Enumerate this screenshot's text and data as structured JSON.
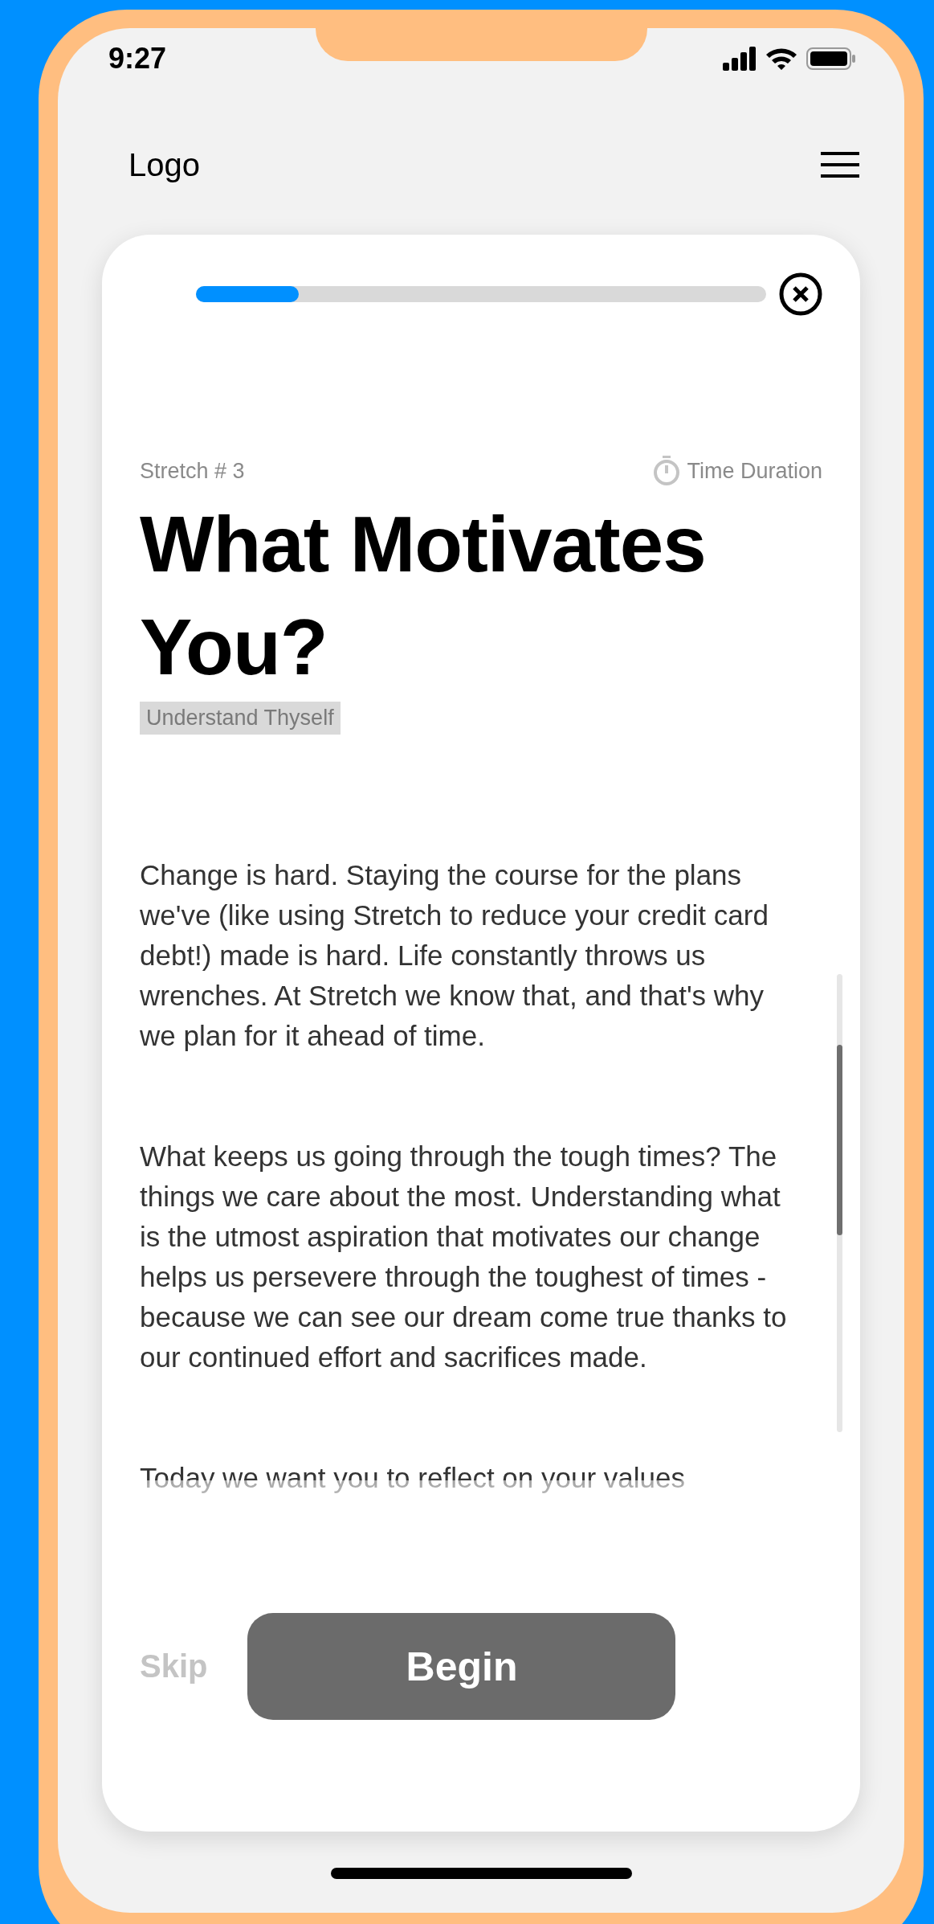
{
  "status_bar": {
    "time": "9:27"
  },
  "header": {
    "logo": "Logo"
  },
  "card": {
    "progress": {
      "level": 0.18
    },
    "stretch_label": "Stretch # 3",
    "duration": "Time Duration",
    "title": "What Motivates You?",
    "tag": "Understand Thyself",
    "paragraphs": [
      "Change is hard. Staying the course for the plans we've (like using Stretch to reduce your credit card debt!) made is hard. Life constantly throws us wrenches. At Stretch we know that, and that's why we plan for it ahead of time.",
      "What keeps us going through the tough times? The things we care about the most. Understanding what is the utmost aspiration that motivates our change helps us persevere through the toughest of times - because we can see our dream come true thanks to our continued effort and sacrifices made.",
      "Today we want you to reflect on your values"
    ],
    "skip": "Skip",
    "begin": "Begin"
  }
}
